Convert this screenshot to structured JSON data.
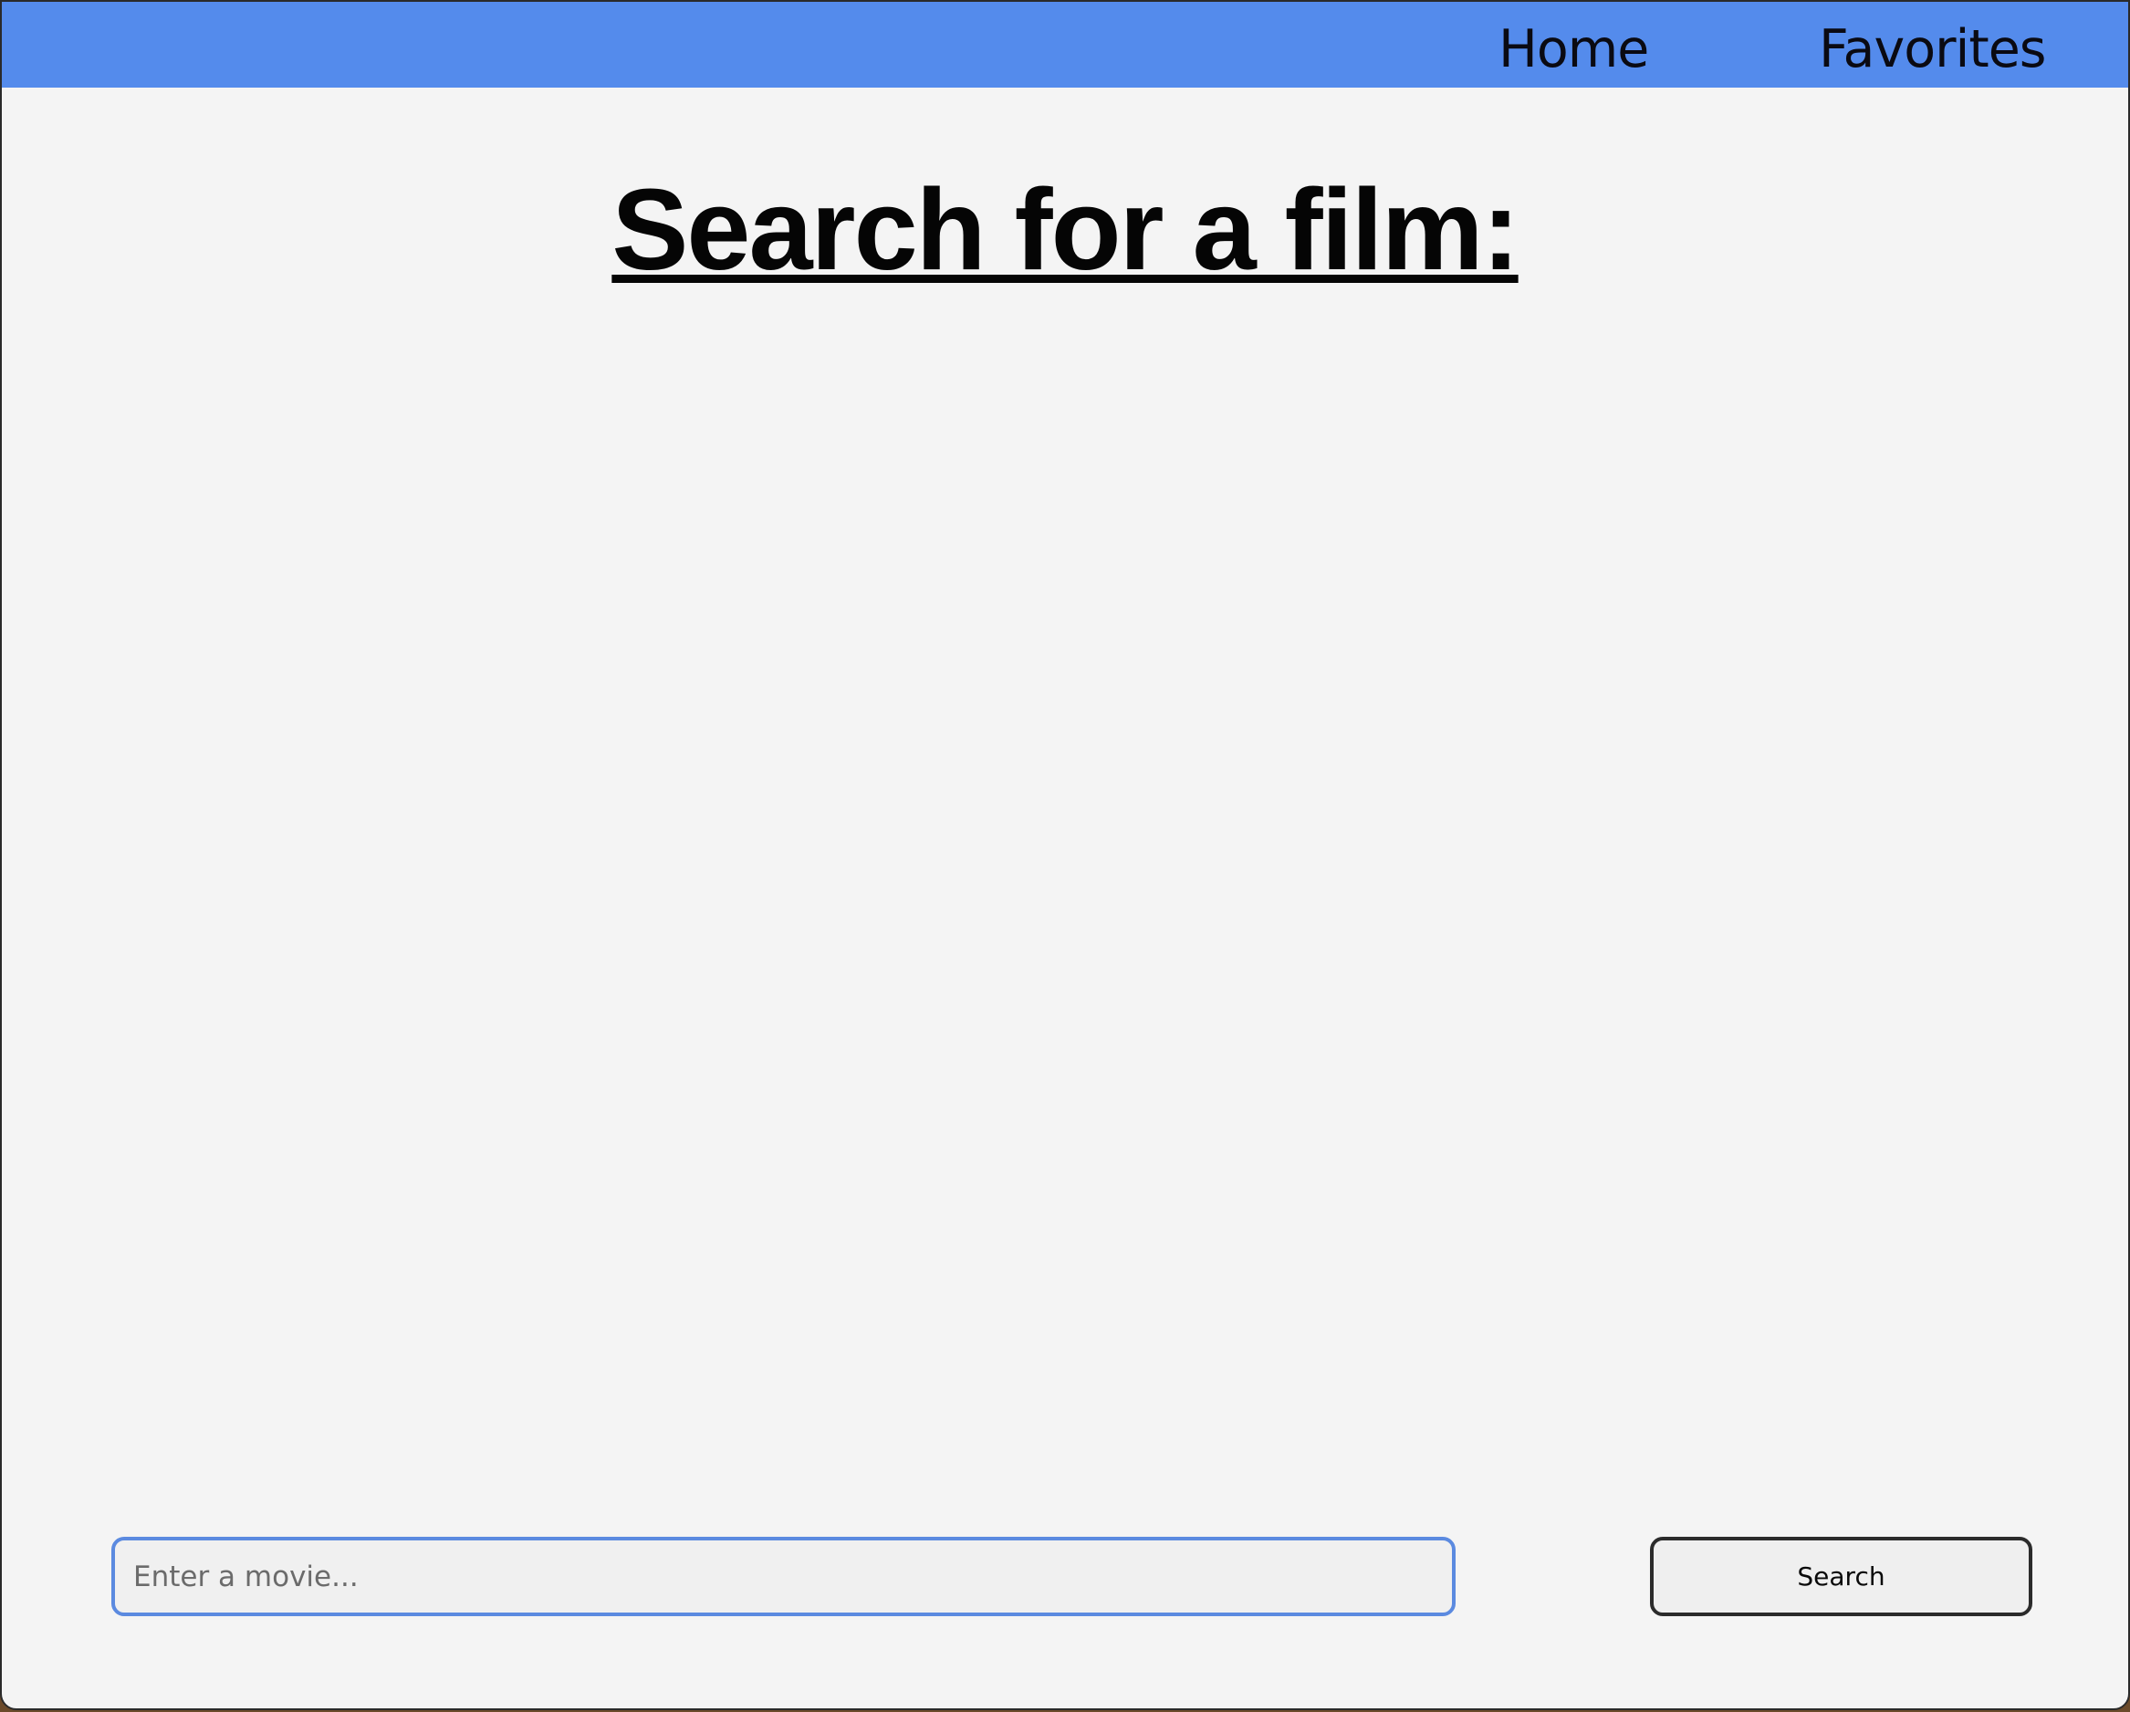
{
  "nav": {
    "items": [
      {
        "label": "Home"
      },
      {
        "label": "Favorites"
      }
    ]
  },
  "main": {
    "title": "Search for a film:"
  },
  "search": {
    "placeholder": "Enter a movie...",
    "value": "",
    "button_label": "Search"
  },
  "colors": {
    "navbar": "#548bec",
    "background": "#f4f4f4",
    "input_border": "#5b8ae0"
  }
}
